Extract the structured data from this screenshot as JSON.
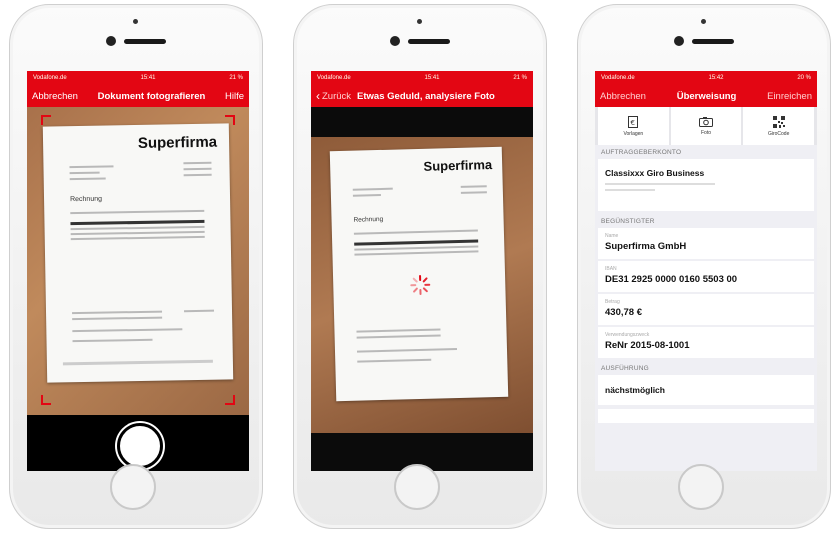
{
  "phone1": {
    "status": {
      "carrier": "Vodafone.de",
      "time": "15:41",
      "battery": "21 %"
    },
    "nav": {
      "left": "Abbrechen",
      "title": "Dokument fotografieren",
      "right": "Hilfe"
    },
    "document": {
      "brand": "Superfirma",
      "heading": "Rechnung"
    }
  },
  "phone2": {
    "status": {
      "carrier": "Vodafone.de",
      "time": "15:41",
      "battery": "21 %"
    },
    "nav": {
      "back": "Zurück",
      "title": "Etwas Geduld, analysiere Foto"
    },
    "document": {
      "brand": "Superfirma",
      "heading": "Rechnung"
    }
  },
  "phone3": {
    "status": {
      "carrier": "Vodafone.de",
      "time": "15:42",
      "battery": "20 %"
    },
    "nav": {
      "left": "Abbrechen",
      "title": "Überweisung",
      "right": "Einreichen"
    },
    "tools": [
      "Vorlagen",
      "Foto",
      "GiroCode"
    ],
    "account_section": "AUFTRAGGEBERKONTO",
    "account_name": "Classixxx Giro Business",
    "payee_section": "BEGÜNSTIGTER",
    "fields": [
      {
        "label": "Name",
        "value": "Superfirma GmbH"
      },
      {
        "label": "IBAN",
        "value": "DE31 2925 0000 0160 5503 00"
      },
      {
        "label": "Betrag",
        "value": "430,78 €"
      },
      {
        "label": "Verwendungszweck",
        "value": "ReNr 2015-08-1001"
      }
    ],
    "execution_section": "AUSFÜHRUNG",
    "execution_value": "nächstmöglich"
  },
  "colors": {
    "accent": "#e30613",
    "background": "#efeff4"
  }
}
